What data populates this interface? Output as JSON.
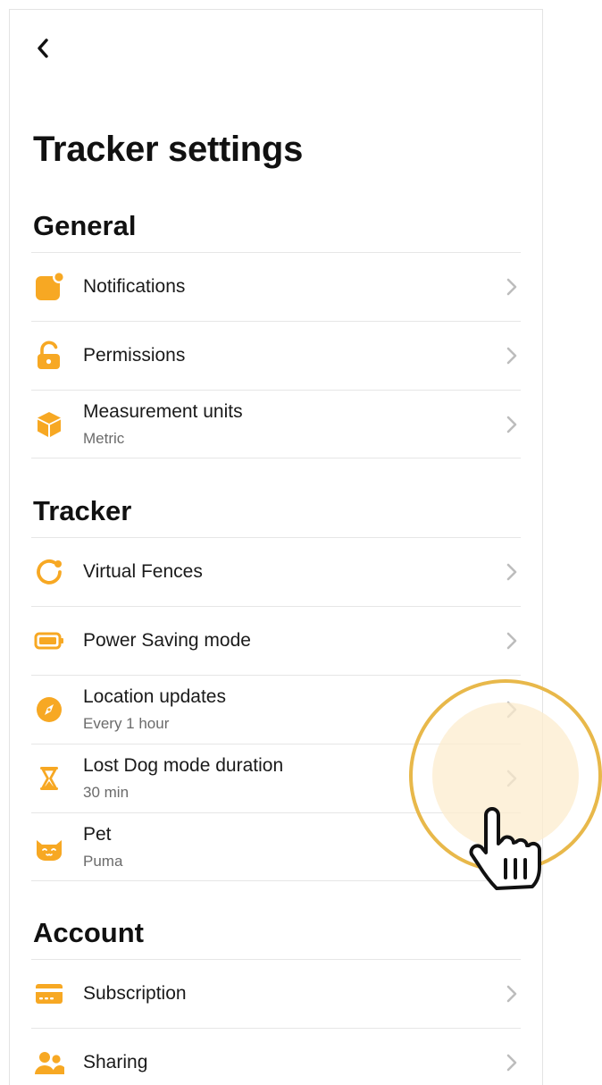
{
  "header": {
    "title": "Tracker settings",
    "back_icon": "chevron-left-icon"
  },
  "colors": {
    "accent": "#F7A823",
    "chevron": "#BDBDBD",
    "divider": "#E6E6E6",
    "tap_ring": "#E8B84A"
  },
  "sections": [
    {
      "title": "General",
      "items": [
        {
          "label": "Notifications",
          "sub": "",
          "icon": "notification-badge-icon"
        },
        {
          "label": "Permissions",
          "sub": "",
          "icon": "unlocked-padlock-icon"
        },
        {
          "label": "Measurement units",
          "sub": "Metric",
          "icon": "cube-icon"
        }
      ]
    },
    {
      "title": "Tracker",
      "items": [
        {
          "label": "Virtual Fences",
          "sub": "",
          "icon": "fence-ring-icon"
        },
        {
          "label": "Power Saving mode",
          "sub": "",
          "icon": "battery-icon"
        },
        {
          "label": "Location updates",
          "sub": "Every 1 hour",
          "icon": "compass-icon"
        },
        {
          "label": "Lost Dog mode duration",
          "sub": "30 min",
          "icon": "hourglass-icon"
        },
        {
          "label": "Pet",
          "sub": "Puma",
          "icon": "cat-face-icon"
        }
      ]
    },
    {
      "title": "Account",
      "items": [
        {
          "label": "Subscription",
          "sub": "",
          "icon": "credit-card-icon"
        },
        {
          "label": "Sharing",
          "sub": "",
          "icon": "people-icon"
        }
      ]
    }
  ]
}
